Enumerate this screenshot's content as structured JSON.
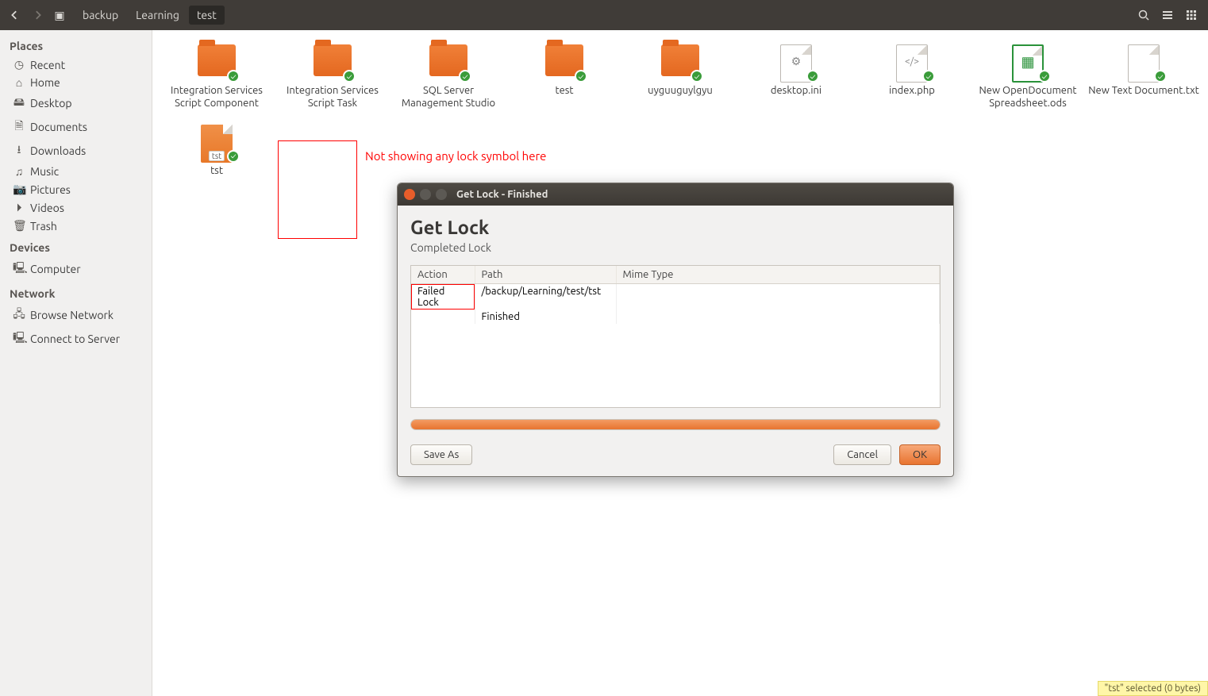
{
  "toolbar": {
    "breadcrumbs": [
      "backup",
      "Learning",
      "test"
    ]
  },
  "sidebar": {
    "sections": [
      {
        "title": "Places",
        "items": [
          {
            "icon": "◷",
            "label": "Recent"
          },
          {
            "icon": "⌂",
            "label": "Home"
          },
          {
            "icon": "🖴",
            "label": "Desktop"
          },
          {
            "icon": "🗎",
            "label": "Documents"
          },
          {
            "icon": "⭳",
            "label": "Downloads"
          },
          {
            "icon": "♫",
            "label": "Music"
          },
          {
            "icon": "📷",
            "label": "Pictures"
          },
          {
            "icon": "⏵",
            "label": "Videos"
          },
          {
            "icon": "🗑",
            "label": "Trash"
          }
        ]
      },
      {
        "title": "Devices",
        "items": [
          {
            "icon": "🖳",
            "label": "Computer"
          }
        ]
      },
      {
        "title": "Network",
        "items": [
          {
            "icon": "🖧",
            "label": "Browse Network"
          },
          {
            "icon": "🖳",
            "label": "Connect to Server"
          }
        ]
      }
    ]
  },
  "files": [
    {
      "type": "folder",
      "label": "Integration Services Script Component"
    },
    {
      "type": "folder",
      "label": "Integration Services Script Task"
    },
    {
      "type": "folder",
      "label": "SQL Server Management Studio"
    },
    {
      "type": "folder",
      "label": "test"
    },
    {
      "type": "folder",
      "label": "uyguuguylgyu"
    },
    {
      "type": "file-ini",
      "label": "desktop.ini"
    },
    {
      "type": "file-code",
      "label": "index.php"
    },
    {
      "type": "file-ods",
      "label": "New OpenDocument Spreadsheet.ods"
    },
    {
      "type": "file-txt",
      "label": "New Text Document.txt"
    },
    {
      "type": "file-orange",
      "label": "tst",
      "ext": "tst"
    }
  ],
  "annotation": {
    "text": "Not showing any lock symbol here"
  },
  "dialog": {
    "title": "Get Lock - Finished",
    "heading": "Get Lock",
    "subtitle": "Completed Lock",
    "columns": {
      "action": "Action",
      "path": "Path",
      "mime": "Mime Type"
    },
    "rows": [
      {
        "action": "Failed Lock",
        "path": "/backup/Learning/test/tst",
        "mime": ""
      },
      {
        "action": "",
        "path": "Finished",
        "mime": ""
      }
    ],
    "buttons": {
      "save": "Save As",
      "cancel": "Cancel",
      "ok": "OK"
    }
  },
  "status": "\"tst\" selected  (0 bytes)"
}
